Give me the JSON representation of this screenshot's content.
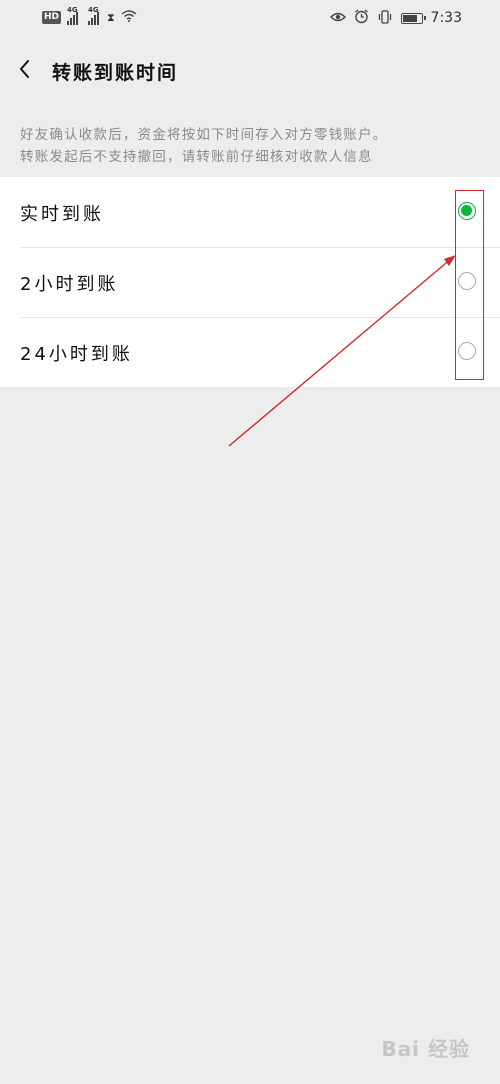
{
  "status_bar": {
    "hd_label": "HD",
    "network_1": "4G",
    "network_2": "4G",
    "time": "7:33",
    "battery_level": 0.85
  },
  "header": {
    "title": "转账到账时间"
  },
  "description": {
    "line1": "好友确认收款后，资金将按如下时间存入对方零钱账户。",
    "line2": "转账发起后不支持撤回，请转账前仔细核对收款人信息"
  },
  "options": [
    {
      "label": "实时到账",
      "selected": true
    },
    {
      "label": "2小时到账",
      "selected": false
    },
    {
      "label": "24小时到账",
      "selected": false
    }
  ],
  "colors": {
    "accent": "#09b83e",
    "annotation": "#d02a2a",
    "background": "#ededed"
  },
  "watermark": {
    "text": "Bai 经验"
  }
}
